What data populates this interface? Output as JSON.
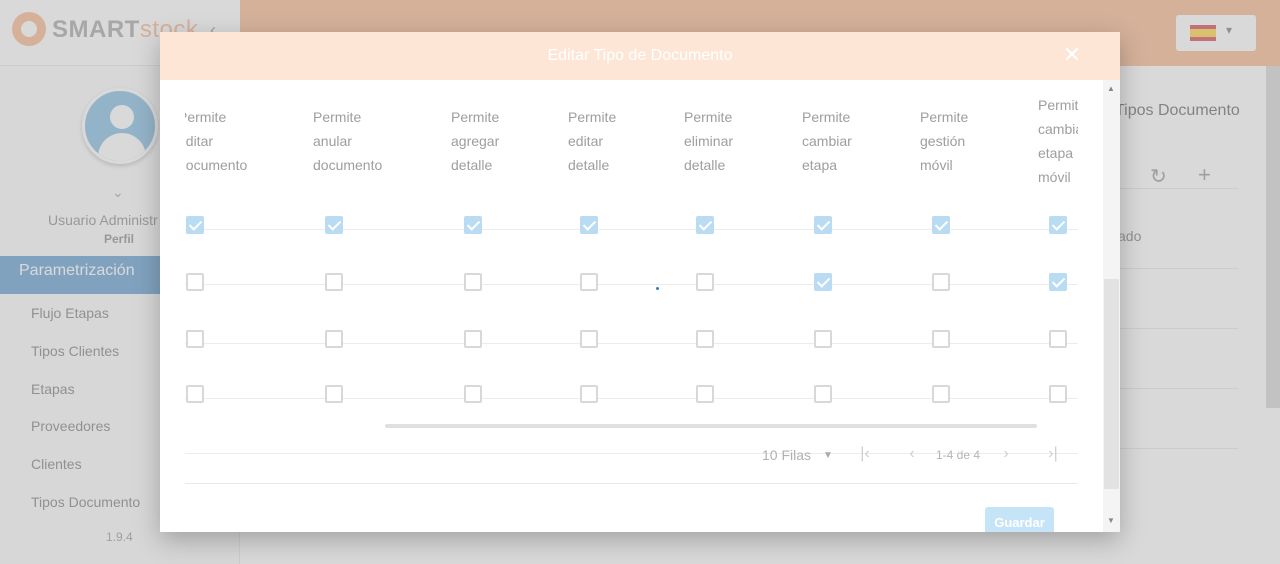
{
  "app": {
    "logo_part1": "SMART",
    "logo_part2": "stock",
    "version": "1.9.4",
    "colors": {
      "brand_orange": "#f7a36b",
      "brand_blue": "#2f7fc1"
    }
  },
  "user": {
    "name": "Usuario Administr",
    "profile_label": "Perfil"
  },
  "sidebar": {
    "active_section": "Parametrización",
    "items": [
      "Flujo Etapas",
      "Tipos Clientes",
      "Etapas",
      "Proveedores",
      "Clientes",
      "Tipos Documento"
    ]
  },
  "background_page": {
    "title": "Tipos Documento",
    "visible_column": "ado"
  },
  "modal": {
    "title": "Editar Tipo de Documento",
    "close_icon": "close-icon",
    "columns": [
      [
        "Permite",
        "editar",
        "documento"
      ],
      [
        "Permite",
        "anular",
        "documento"
      ],
      [
        "Permite",
        "agregar",
        "detalle"
      ],
      [
        "Permite",
        "editar",
        "detalle"
      ],
      [
        "Permite",
        "eliminar",
        "detalle"
      ],
      [
        "Permite",
        "cambiar",
        "etapa"
      ],
      [
        "Permite",
        "gestión",
        "móvil"
      ],
      [
        "Permite",
        "cambiar",
        "etapa",
        "móvil"
      ]
    ],
    "rows": [
      [
        true,
        true,
        true,
        true,
        true,
        true,
        true,
        true
      ],
      [
        false,
        false,
        false,
        false,
        false,
        true,
        false,
        true
      ],
      [
        false,
        false,
        false,
        false,
        false,
        false,
        false,
        false
      ],
      [
        false,
        false,
        false,
        false,
        false,
        false,
        false,
        false
      ]
    ],
    "pagination": {
      "rows_per_page": "10 Filas",
      "range": "1-4 de 4"
    },
    "save_label": "Guardar"
  }
}
